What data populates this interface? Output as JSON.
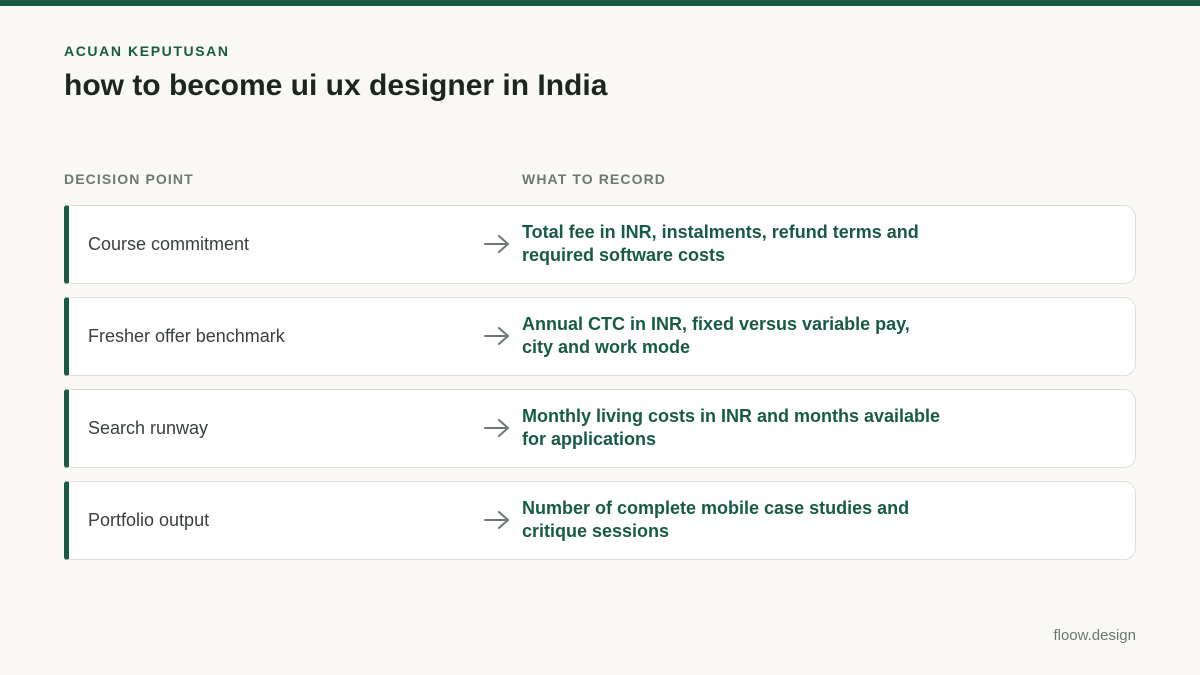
{
  "header": {
    "eyebrow": "ACUAN KEPUTUSAN",
    "title": "how to become ui ux designer in India"
  },
  "table": {
    "columns": {
      "decision": "DECISION POINT",
      "record": "WHAT TO RECORD"
    },
    "rows": [
      {
        "label": "Course commitment",
        "value": "Total fee in INR, instalments, refund terms and required software costs"
      },
      {
        "label": "Fresher offer benchmark",
        "value": "Annual CTC in INR, fixed versus variable pay, city and work mode"
      },
      {
        "label": "Search runway",
        "value": "Monthly living costs in INR and months available for applications"
      },
      {
        "label": "Portfolio output",
        "value": "Number of complete mobile case studies and critique sessions"
      }
    ]
  },
  "footer": {
    "brand": "floow.design"
  },
  "colors": {
    "accent": "#185b45",
    "background": "#f9f8f4",
    "card": "#ffffff",
    "muted": "#6e7872"
  },
  "icons": {
    "row_arrow": "arrow-right-icon"
  }
}
